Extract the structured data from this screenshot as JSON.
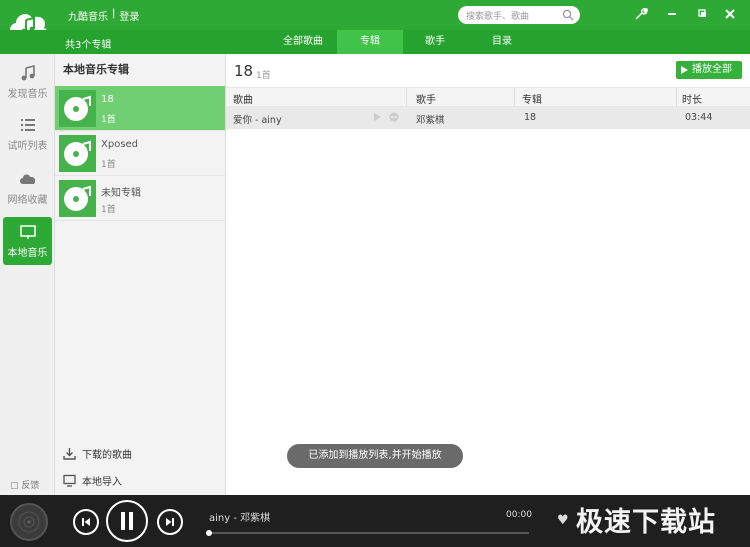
{
  "header": {
    "app_name": "九酷音乐",
    "separator": "|",
    "login": "登录",
    "search_placeholder": "搜索歌手、歌曲"
  },
  "tabs": {
    "album_count": "共3个专辑",
    "items": [
      {
        "label": "全部歌曲"
      },
      {
        "label": "专辑",
        "active": true
      },
      {
        "label": "歌手"
      },
      {
        "label": "目录"
      }
    ]
  },
  "sidebar": {
    "items": [
      {
        "label": "发现音乐",
        "icon": "music-note-icon"
      },
      {
        "label": "试听列表",
        "icon": "list-icon"
      },
      {
        "label": "网络收藏",
        "icon": "cloud-icon"
      },
      {
        "label": "本地音乐",
        "icon": "monitor-icon",
        "active": true
      }
    ],
    "feedback": "反馈"
  },
  "albums": {
    "header": "本地音乐专辑",
    "items": [
      {
        "name": "18",
        "count": "1首",
        "active": true
      },
      {
        "name": "Xposed",
        "count": "1首"
      },
      {
        "name": "未知专辑",
        "count": "1首"
      }
    ],
    "downloaded": "下载的歌曲",
    "import": "本地导入"
  },
  "main": {
    "title": "18",
    "subtitle": "1首",
    "play_all": "播放全部",
    "columns": [
      "歌曲",
      "歌手",
      "专辑",
      "时长"
    ],
    "rows": [
      {
        "song": "爱你 - ainy",
        "artist": "邓紫棋",
        "album": "18",
        "duration": "03:44"
      }
    ]
  },
  "toast": "已添加到播放列表,并开始播放",
  "player": {
    "track": "ainy - 邓紫棋",
    "time": "00:00",
    "progress": 0.0
  },
  "watermark": "极速下载站",
  "colors": {
    "brand": "#2fa935",
    "tab_active": "#41c34a",
    "album_active": "#6fcf72",
    "player_bg": "#1f1f1f"
  }
}
